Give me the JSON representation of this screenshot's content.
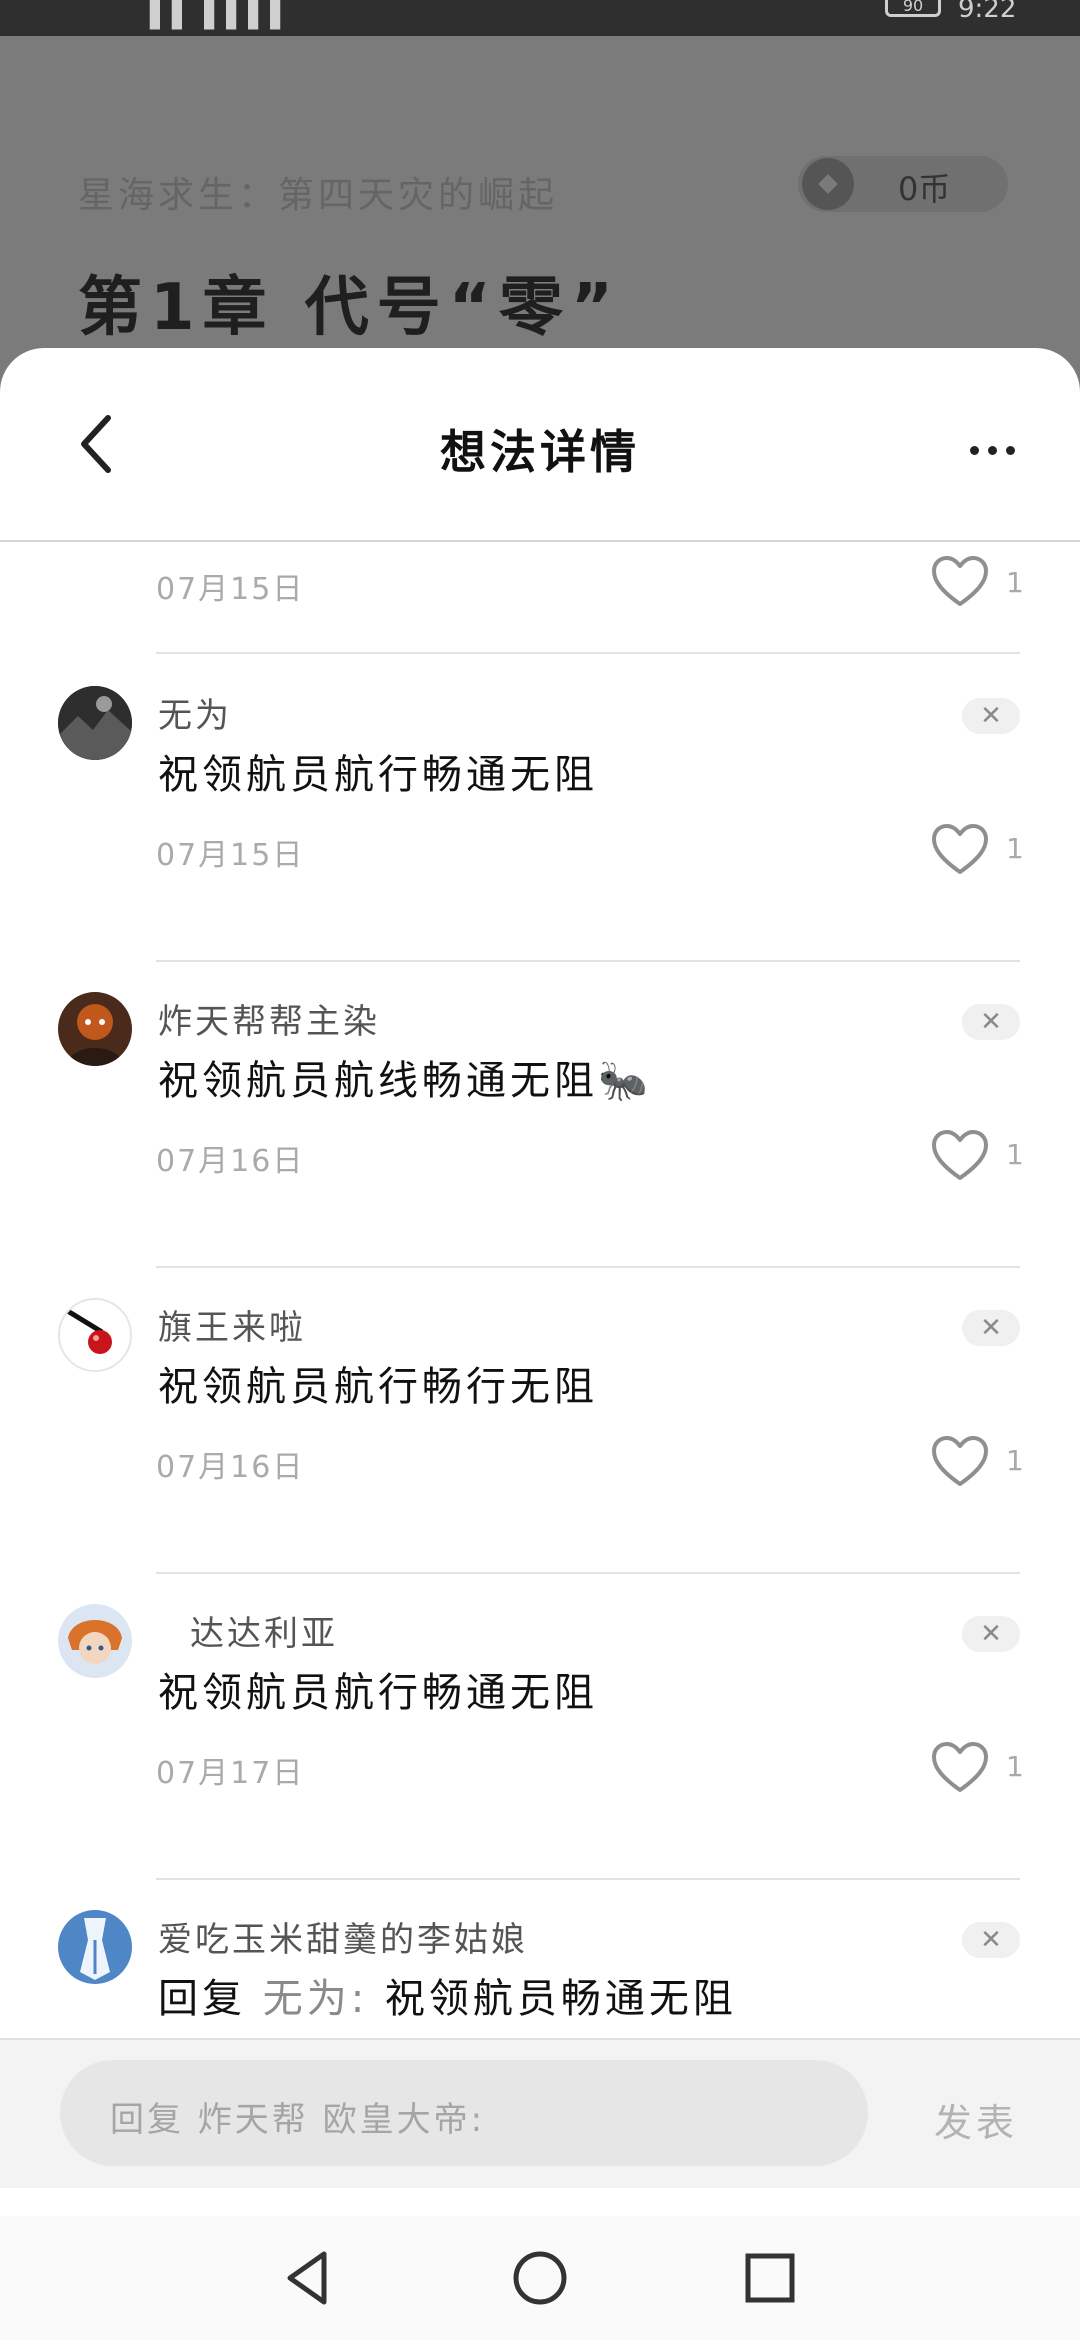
{
  "status_bar": {
    "left": "▌▌ ▌▌▌▌",
    "battery": "90",
    "time": "9:22"
  },
  "background": {
    "book_title": "星海求生：第四天灾的崛起",
    "coins": "0币",
    "chapter_title": "第1章 代号“零”"
  },
  "sheet": {
    "title": "想法详情"
  },
  "icons": {
    "back": "chevron-left-icon",
    "more": "more-dots-icon",
    "like": "heart-outline-icon",
    "close": "close-icon"
  },
  "comments": [
    {
      "username": "",
      "content": "",
      "date": "07月15日",
      "likes": "1"
    },
    {
      "username": "无为",
      "content": "祝领航员航行畅通无阻",
      "date": "07月15日",
      "likes": "1"
    },
    {
      "username": "炸天帮帮主染",
      "content": "祝领航员航线畅通无阻🐜",
      "date": "07月16日",
      "likes": "1"
    },
    {
      "username": "旗王来啦",
      "content": "祝领航员航行畅行无阻",
      "date": "07月16日",
      "likes": "1"
    },
    {
      "username": "达达利亚",
      "content": "祝领航员航行畅通无阻",
      "date": "07月17日",
      "likes": "1"
    },
    {
      "username": "爱吃玉米甜羹的李姑娘",
      "reply_prefix": "回复",
      "reply_to": "无为:",
      "content": "祝领航员畅通无阻"
    }
  ],
  "reply_bar": {
    "placeholder": "回复 炸天帮 欧皇大帝:",
    "post_label": "发表"
  },
  "navbar": {
    "back": "nav-back-icon",
    "home": "nav-home-icon",
    "recents": "nav-recents-icon"
  }
}
